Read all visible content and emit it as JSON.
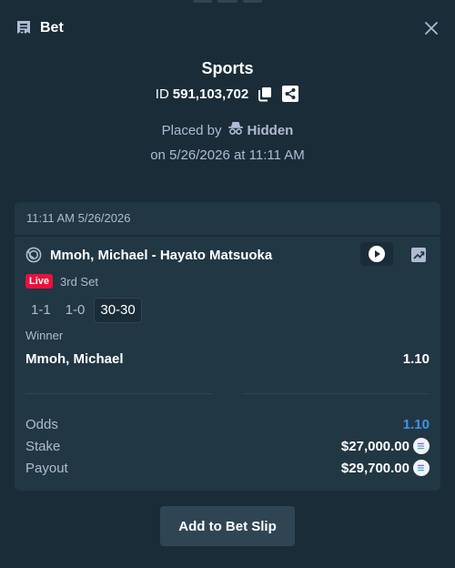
{
  "header": {
    "title": "Bet",
    "close_icon": "close-icon",
    "bet_icon": "receipt-icon"
  },
  "summary": {
    "sport": "Sports",
    "id_label": "ID",
    "id_value": "591,103,702",
    "placed_by_label": "Placed by",
    "placed_by_user": "Hidden",
    "placed_on": "on 5/26/2026 at 11:11 AM"
  },
  "card": {
    "timestamp": "11:11 AM 5/26/2026",
    "match": "Mmoh, Michael - Hayato Matsuoka",
    "live_label": "Live",
    "period": "3rd Set",
    "scores": [
      "1-1",
      "1-0",
      "30-30"
    ],
    "market": "Winner",
    "selection": "Mmoh, Michael",
    "selection_odds": "1.10",
    "totals": {
      "odds_label": "Odds",
      "odds_value": "1.10",
      "stake_label": "Stake",
      "stake_value": "$27,000.00",
      "payout_label": "Payout",
      "payout_value": "$29,700.00"
    }
  },
  "footer": {
    "add_button": "Add to Bet Slip"
  },
  "colors": {
    "background": "#1a2c38",
    "card": "#213743",
    "accent_odds": "#4391e7",
    "live": "#e9113c",
    "button": "#2f4553"
  }
}
